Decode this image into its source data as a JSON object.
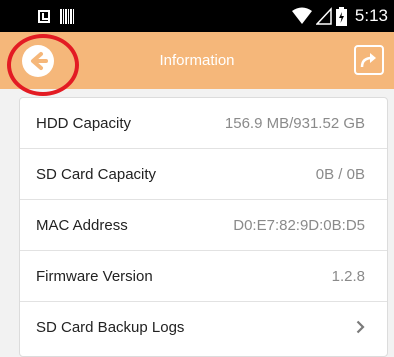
{
  "status_bar": {
    "time": "5:13",
    "icons": [
      "download-icon",
      "barcode-icon",
      "wifi-icon",
      "signal-icon",
      "battery-charging-icon"
    ]
  },
  "app_bar": {
    "title": "Information",
    "back_icon": "back-arrow-icon",
    "share_icon": "share-icon",
    "background_color": "#f5b77a",
    "highlight_color": "#e31b23"
  },
  "info_rows": [
    {
      "label": "HDD Capacity",
      "value": "156.9 MB/931.52 GB"
    },
    {
      "label": "SD Card Capacity",
      "value": "0B / 0B"
    },
    {
      "label": "MAC Address",
      "value": "D0:E7:82:9D:0B:D5"
    },
    {
      "label": "Firmware Version",
      "value": "1.2.8"
    },
    {
      "label": "SD Card Backup Logs",
      "icon": "chevron-right-icon"
    }
  ]
}
